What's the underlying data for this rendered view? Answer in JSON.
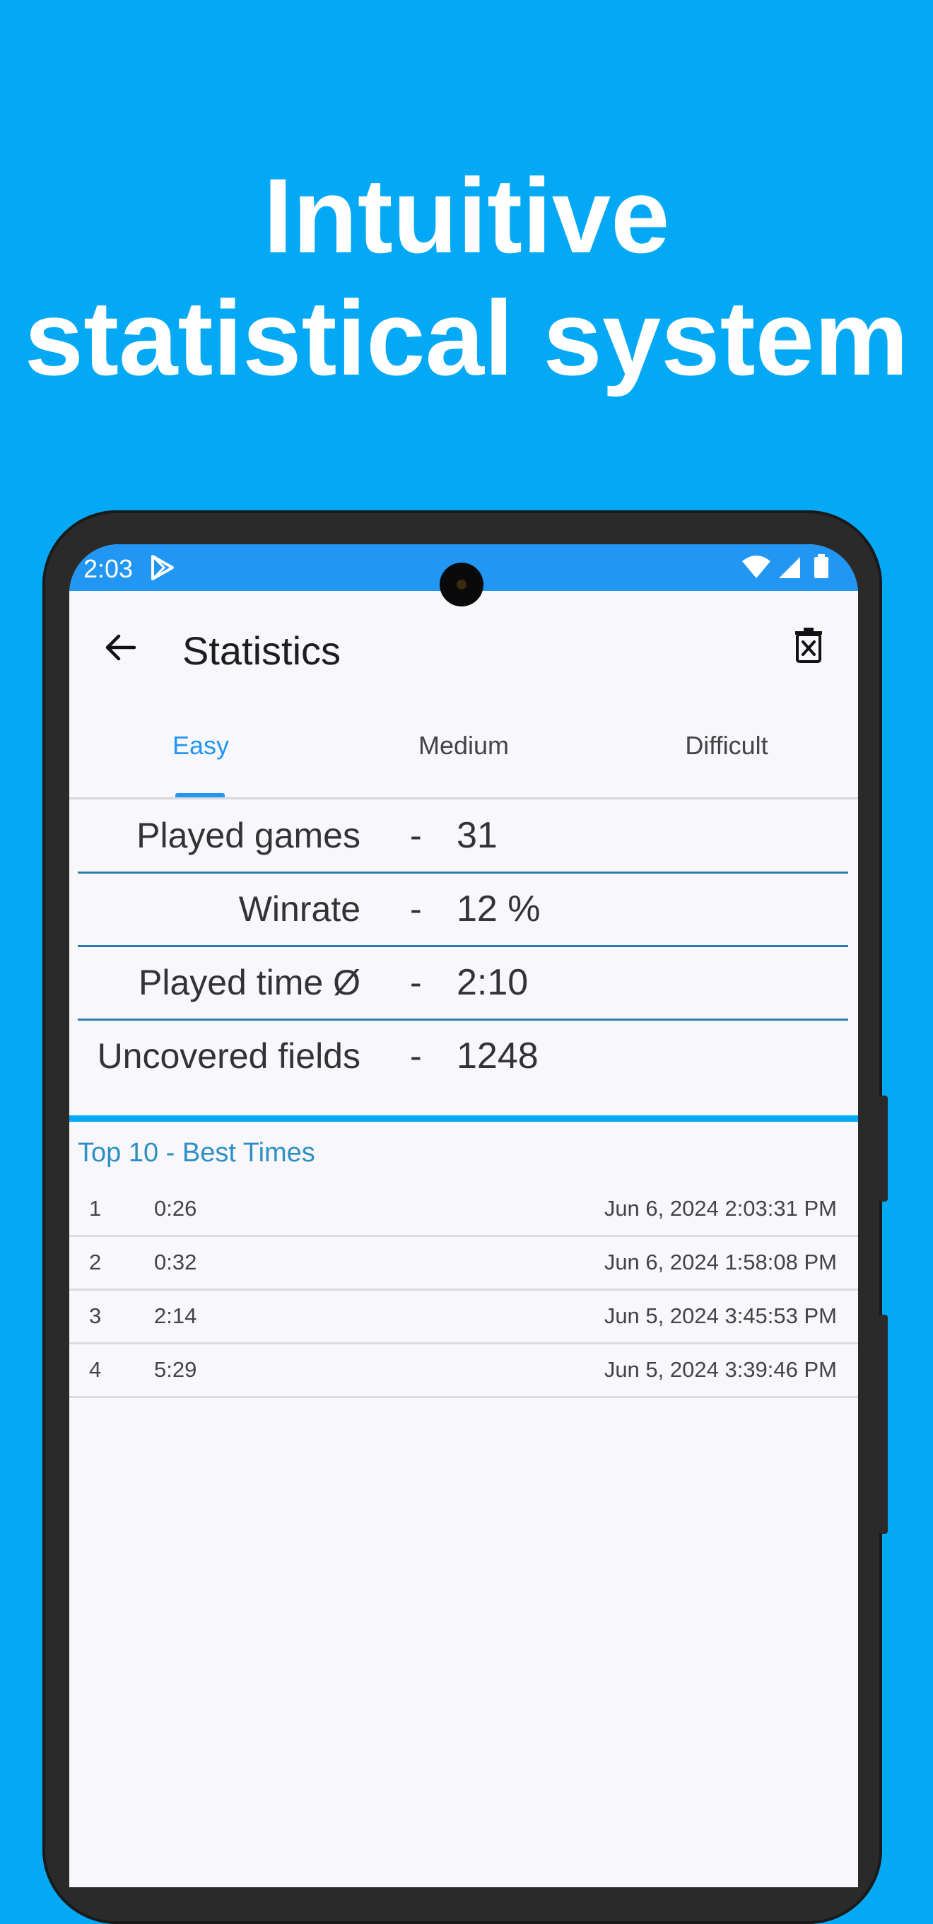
{
  "headline": {
    "line1": "Intuitive",
    "line2": "statistical system"
  },
  "status_bar": {
    "time": "2:03"
  },
  "app_bar": {
    "title": "Statistics"
  },
  "tabs": [
    {
      "label": "Easy",
      "active": true
    },
    {
      "label": "Medium",
      "active": false
    },
    {
      "label": "Difficult",
      "active": false
    }
  ],
  "stats": [
    {
      "label": "Played games",
      "separator": "-",
      "value": "31"
    },
    {
      "label": "Winrate",
      "separator": "-",
      "value": "12 %"
    },
    {
      "label": "Played time Ø",
      "separator": "-",
      "value": "2:10"
    },
    {
      "label": "Uncovered fields",
      "separator": "-",
      "value": "1248"
    }
  ],
  "best_times": {
    "title": "Top 10 - Best Times",
    "rows": [
      {
        "rank": "1",
        "time": "0:26",
        "date": "Jun 6, 2024 2:03:31 PM"
      },
      {
        "rank": "2",
        "time": "0:32",
        "date": "Jun 6, 2024 1:58:08 PM"
      },
      {
        "rank": "3",
        "time": "2:14",
        "date": "Jun 5, 2024 3:45:53 PM"
      },
      {
        "rank": "4",
        "time": "5:29",
        "date": "Jun 5, 2024 3:39:46 PM"
      }
    ]
  },
  "colors": {
    "background": "#03A9F4",
    "status_bar": "#2196F3",
    "accent": "#2196F3",
    "screen": "#F7F7FC"
  }
}
